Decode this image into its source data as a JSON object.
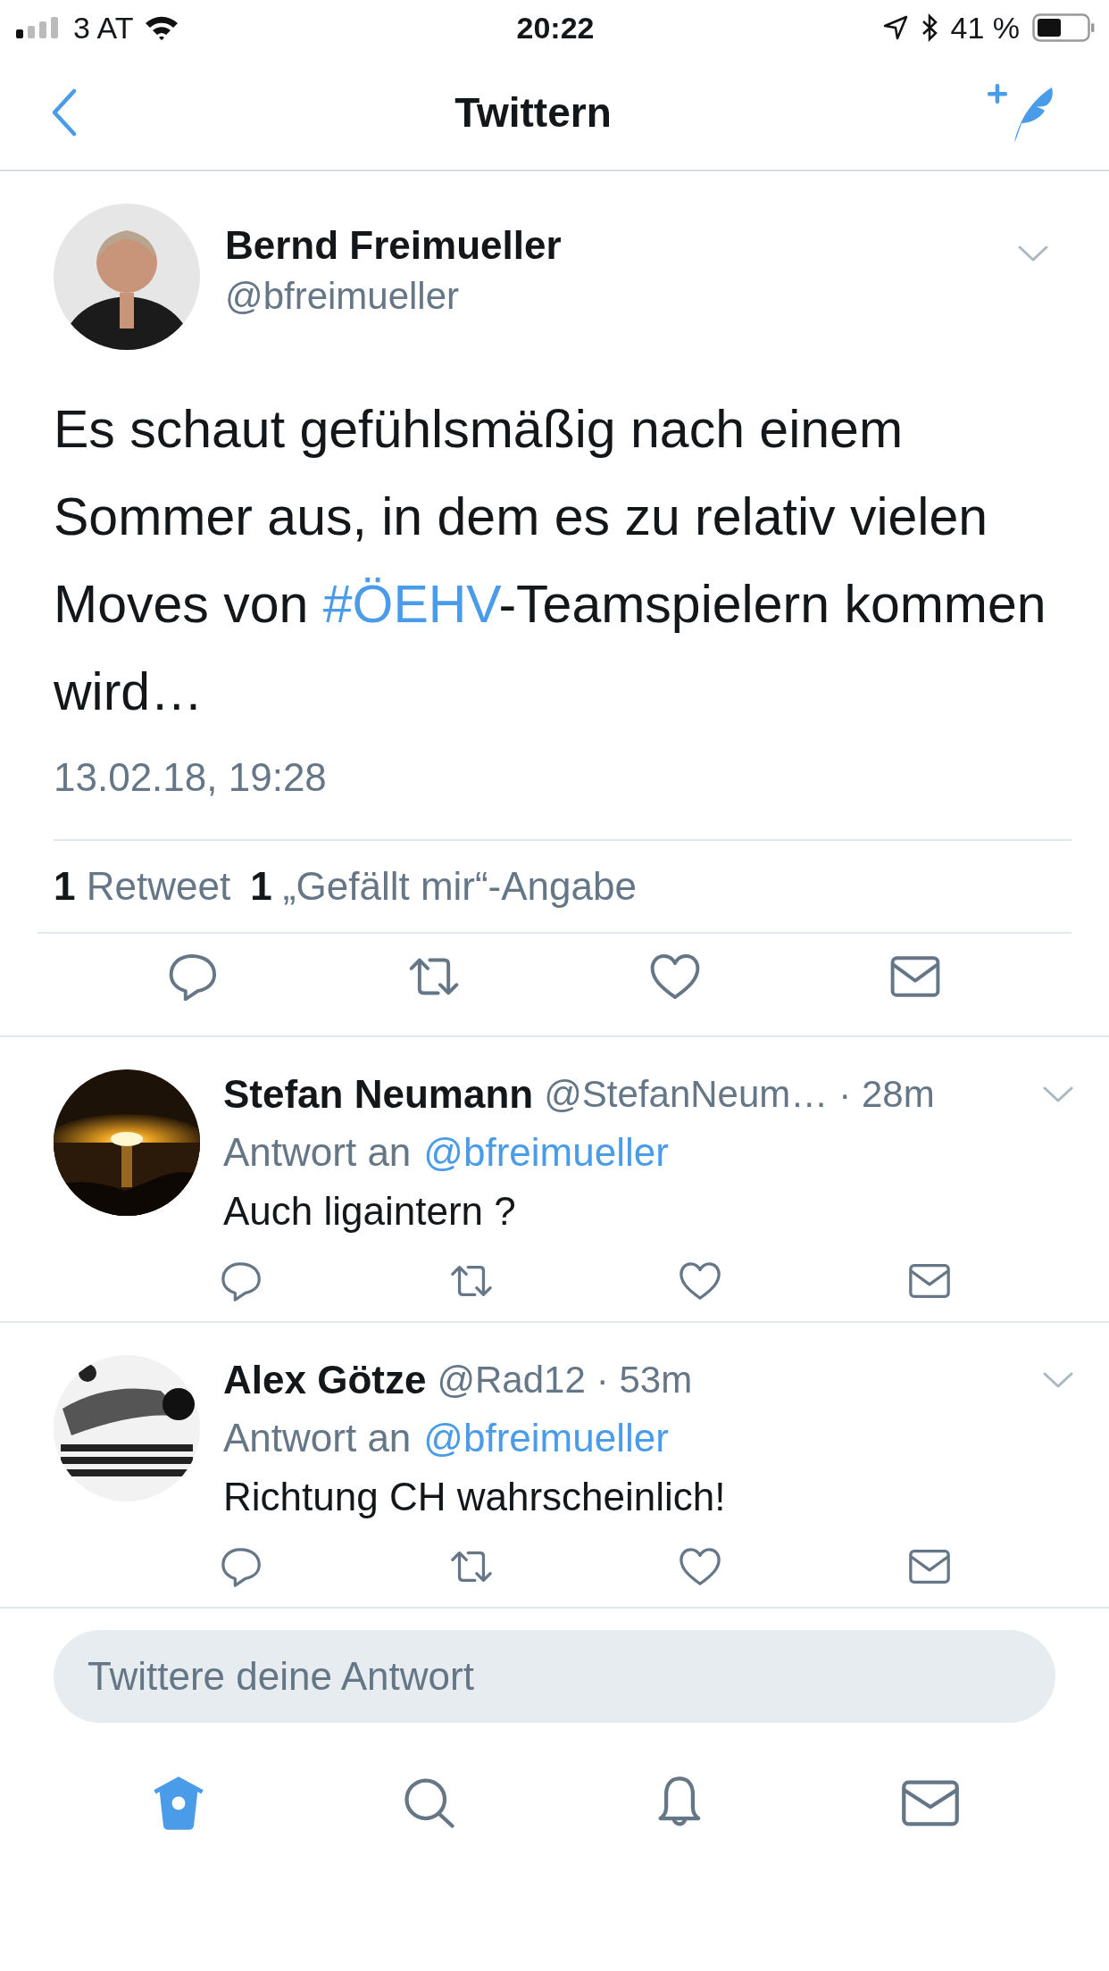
{
  "status_bar": {
    "carrier": "3 AT",
    "time": "20:22",
    "battery": "41 %"
  },
  "nav": {
    "title": "Twittern"
  },
  "tweet": {
    "name": "Bernd Freimueller",
    "handle": "@bfreimueller",
    "text": [
      {
        "kind": "plain",
        "text": "Es schaut gefühlsmäßig nach einem Sommer aus, in dem es zu relativ vielen Moves von "
      },
      {
        "kind": "hashtag",
        "text": "#ÖEHV"
      },
      {
        "kind": "plain",
        "text": "-Teamspielern kommen wird…"
      }
    ],
    "date": "13.02.18, 19:28",
    "stats": [
      "**1** Retweet",
      "**1** „Gefällt mir“-Angabe"
    ]
  },
  "replies": [
    {
      "name": "Stefan Neumann",
      "handle": "@StefanNeum…",
      "time": "· 28m",
      "reply_label": "Antwort an",
      "reply_handle": "@bfreimueller",
      "text": "Auch ligaintern ?"
    },
    {
      "name": "Alex Götze",
      "handle": "@Rad12",
      "time": "· 53m",
      "reply_label": "Antwort an",
      "reply_handle": "@bfreimueller",
      "text": "Richtung CH wahrscheinlich!"
    }
  ],
  "reply_field": {
    "placeholder": "Twittere deine Antwort"
  },
  "tab_bar": [
    {
      "selected": true
    },
    {
      "selected": false
    },
    {
      "selected": false
    },
    {
      "selected": false
    }
  ]
}
